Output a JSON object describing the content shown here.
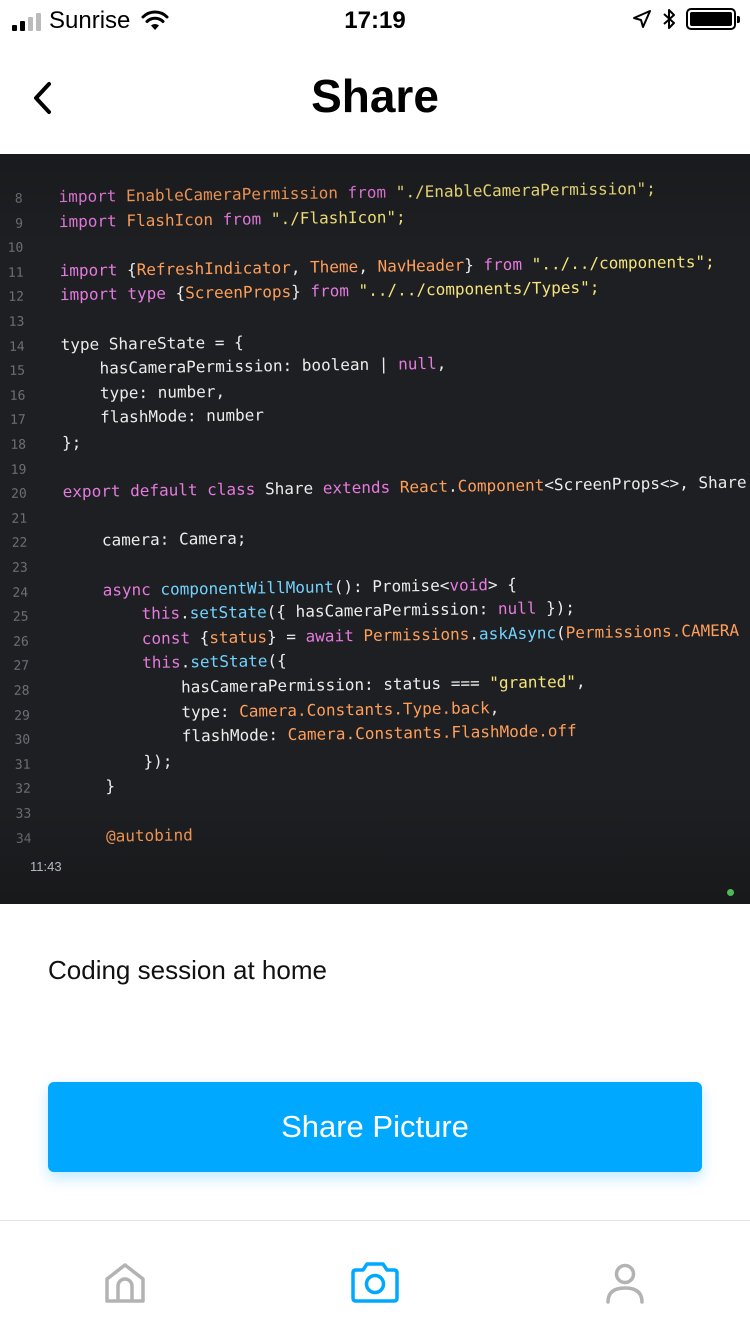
{
  "status_bar": {
    "carrier": "Sunrise",
    "time": "17:19",
    "battery_level": 1.0
  },
  "nav": {
    "title": "Share"
  },
  "photo": {
    "code_lines": [
      {
        "n": "8",
        "parts": [
          [
            "kw",
            "import "
          ],
          [
            "typ",
            "EnableCameraPermission "
          ],
          [
            "kw",
            "from "
          ],
          [
            "str",
            "\"./EnableCameraPermission\";"
          ]
        ]
      },
      {
        "n": "9",
        "parts": [
          [
            "kw",
            "import "
          ],
          [
            "typ",
            "FlashIcon "
          ],
          [
            "kw",
            "from "
          ],
          [
            "str",
            "\"./FlashIcon\";"
          ]
        ]
      },
      {
        "n": "10",
        "parts": []
      },
      {
        "n": "11",
        "parts": [
          [
            "kw",
            "import "
          ],
          [
            "plain",
            "{"
          ],
          [
            "typ",
            "RefreshIndicator"
          ],
          [
            "plain",
            ", "
          ],
          [
            "typ",
            "Theme"
          ],
          [
            "plain",
            ", "
          ],
          [
            "typ",
            "NavHeader"
          ],
          [
            "plain",
            "} "
          ],
          [
            "kw",
            "from "
          ],
          [
            "str",
            "\"../../components\";"
          ]
        ]
      },
      {
        "n": "12",
        "parts": [
          [
            "kw",
            "import type "
          ],
          [
            "plain",
            "{"
          ],
          [
            "typ",
            "ScreenProps"
          ],
          [
            "plain",
            "} "
          ],
          [
            "kw",
            "from "
          ],
          [
            "str",
            "\"../../components/Types\";"
          ]
        ]
      },
      {
        "n": "13",
        "parts": []
      },
      {
        "n": "14",
        "parts": [
          [
            "plain",
            "type ShareState = {"
          ]
        ]
      },
      {
        "n": "15",
        "parts": [
          [
            "plain",
            "    hasCameraPermission: boolean | "
          ],
          [
            "kw",
            "null"
          ],
          [
            "plain",
            ","
          ]
        ]
      },
      {
        "n": "16",
        "parts": [
          [
            "plain",
            "    type: number,"
          ]
        ]
      },
      {
        "n": "17",
        "parts": [
          [
            "plain",
            "    flashMode: number"
          ]
        ]
      },
      {
        "n": "18",
        "parts": [
          [
            "plain",
            "};"
          ]
        ]
      },
      {
        "n": "19",
        "parts": []
      },
      {
        "n": "20",
        "parts": [
          [
            "kw",
            "export default class "
          ],
          [
            "plain",
            "Share "
          ],
          [
            "kw",
            "extends "
          ],
          [
            "typ",
            "React"
          ],
          [
            "plain",
            "."
          ],
          [
            "typ",
            "Component"
          ],
          [
            "plain",
            "<ScreenProps<>, Share"
          ]
        ]
      },
      {
        "n": "21",
        "parts": []
      },
      {
        "n": "22",
        "parts": [
          [
            "plain",
            "    camera: Camera;"
          ]
        ]
      },
      {
        "n": "23",
        "parts": []
      },
      {
        "n": "24",
        "parts": [
          [
            "kw",
            "    async "
          ],
          [
            "fn",
            "componentWillMount"
          ],
          [
            "plain",
            "(): Promise<"
          ],
          [
            "kw",
            "void"
          ],
          [
            "plain",
            "> {"
          ]
        ]
      },
      {
        "n": "25",
        "parts": [
          [
            "kw",
            "        this"
          ],
          [
            "plain",
            "."
          ],
          [
            "fn",
            "setState"
          ],
          [
            "plain",
            "({ hasCameraPermission: "
          ],
          [
            "kw",
            "null"
          ],
          [
            "plain",
            " });"
          ]
        ]
      },
      {
        "n": "26",
        "parts": [
          [
            "kw",
            "        const "
          ],
          [
            "plain",
            "{"
          ],
          [
            "typ",
            "status"
          ],
          [
            "plain",
            "} = "
          ],
          [
            "kw",
            "await "
          ],
          [
            "typ",
            "Permissions"
          ],
          [
            "plain",
            "."
          ],
          [
            "fn",
            "askAsync"
          ],
          [
            "plain",
            "("
          ],
          [
            "typ",
            "Permissions.CAMERA"
          ]
        ]
      },
      {
        "n": "27",
        "parts": [
          [
            "kw",
            "        this"
          ],
          [
            "plain",
            "."
          ],
          [
            "fn",
            "setState"
          ],
          [
            "plain",
            "({"
          ]
        ]
      },
      {
        "n": "28",
        "parts": [
          [
            "plain",
            "            hasCameraPermission: status === "
          ],
          [
            "str",
            "\"granted\""
          ],
          [
            "plain",
            ","
          ]
        ]
      },
      {
        "n": "29",
        "parts": [
          [
            "plain",
            "            type: "
          ],
          [
            "typ",
            "Camera.Constants.Type.back"
          ],
          [
            "plain",
            ","
          ]
        ]
      },
      {
        "n": "30",
        "parts": [
          [
            "plain",
            "            flashMode: "
          ],
          [
            "typ",
            "Camera.Constants.FlashMode.off"
          ]
        ]
      },
      {
        "n": "31",
        "parts": [
          [
            "plain",
            "        });"
          ]
        ]
      },
      {
        "n": "32",
        "parts": [
          [
            "plain",
            "    }"
          ]
        ]
      },
      {
        "n": "33",
        "parts": []
      },
      {
        "n": "34",
        "parts": [
          [
            "typ",
            "    @autobind"
          ]
        ]
      }
    ],
    "screen_time": "11:43"
  },
  "caption": "Coding session at home",
  "share_button_label": "Share Picture",
  "tabs": [
    {
      "name": "home",
      "icon": "home-icon",
      "active": false
    },
    {
      "name": "camera",
      "icon": "camera-icon",
      "active": true
    },
    {
      "name": "profile",
      "icon": "user-icon",
      "active": false
    }
  ],
  "colors": {
    "accent": "#00a8ff",
    "inactive_icon": "#b3b3b3"
  }
}
